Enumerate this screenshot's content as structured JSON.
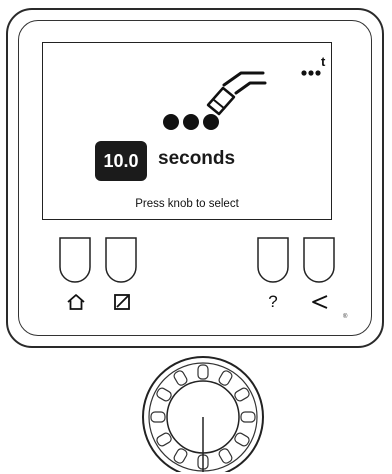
{
  "screen": {
    "value": "10.0",
    "unit": "seconds",
    "prompt": "Press knob to select",
    "more_indicator": "...t"
  },
  "icons": {
    "graphic": "welding-torch-icon",
    "button1": "home-icon",
    "button2": "edit-icon",
    "button3": "help-icon",
    "button4": "back-icon"
  },
  "buttons": {
    "help_label": "?"
  },
  "registered_mark": "®"
}
